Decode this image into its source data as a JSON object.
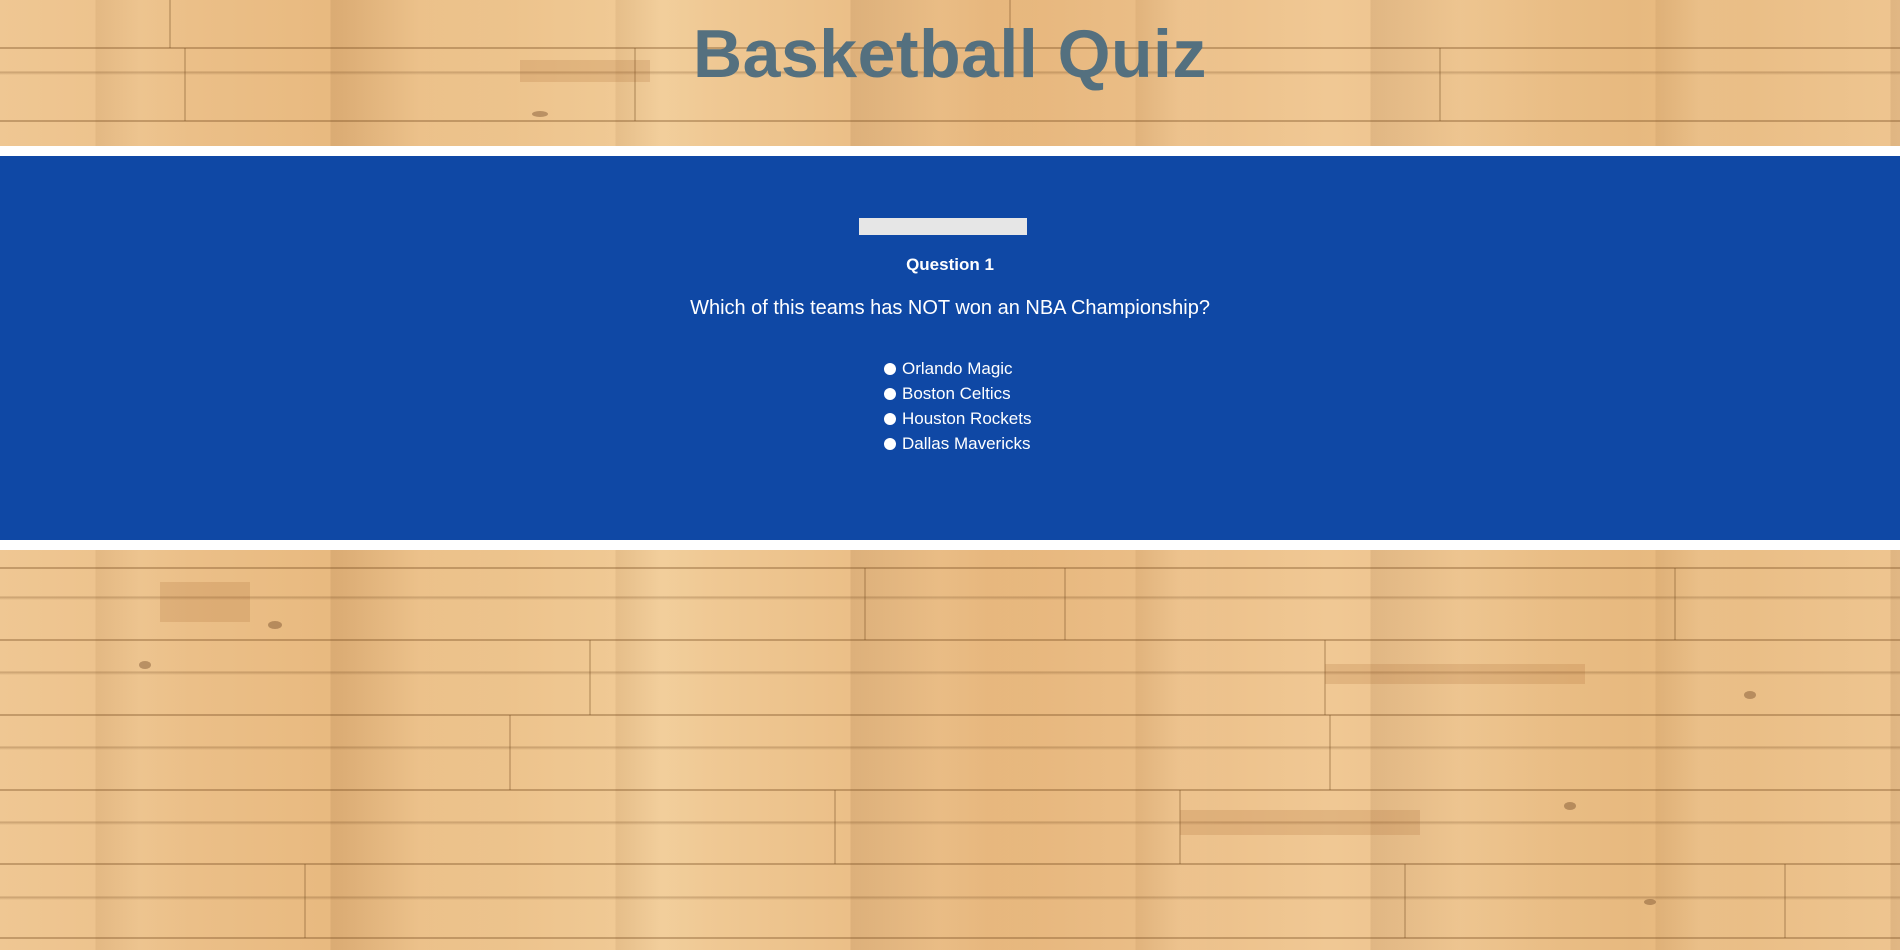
{
  "header": {
    "title": "Basketball Quiz"
  },
  "quiz": {
    "progress_fraction": 1.0,
    "question_number": "Question 1",
    "question_text": "Which of this teams has NOT won an NBA Championship?",
    "answers": [
      {
        "label": "Orlando Magic"
      },
      {
        "label": "Boston Celtics"
      },
      {
        "label": "Houston Rockets"
      },
      {
        "label": "Dallas Mavericks"
      }
    ]
  },
  "colors": {
    "title": "#54707f",
    "panel": "#0f48a5",
    "panel_border": "#ffffff",
    "progress_fill": "#e6e6e6",
    "text": "#ffffff"
  }
}
